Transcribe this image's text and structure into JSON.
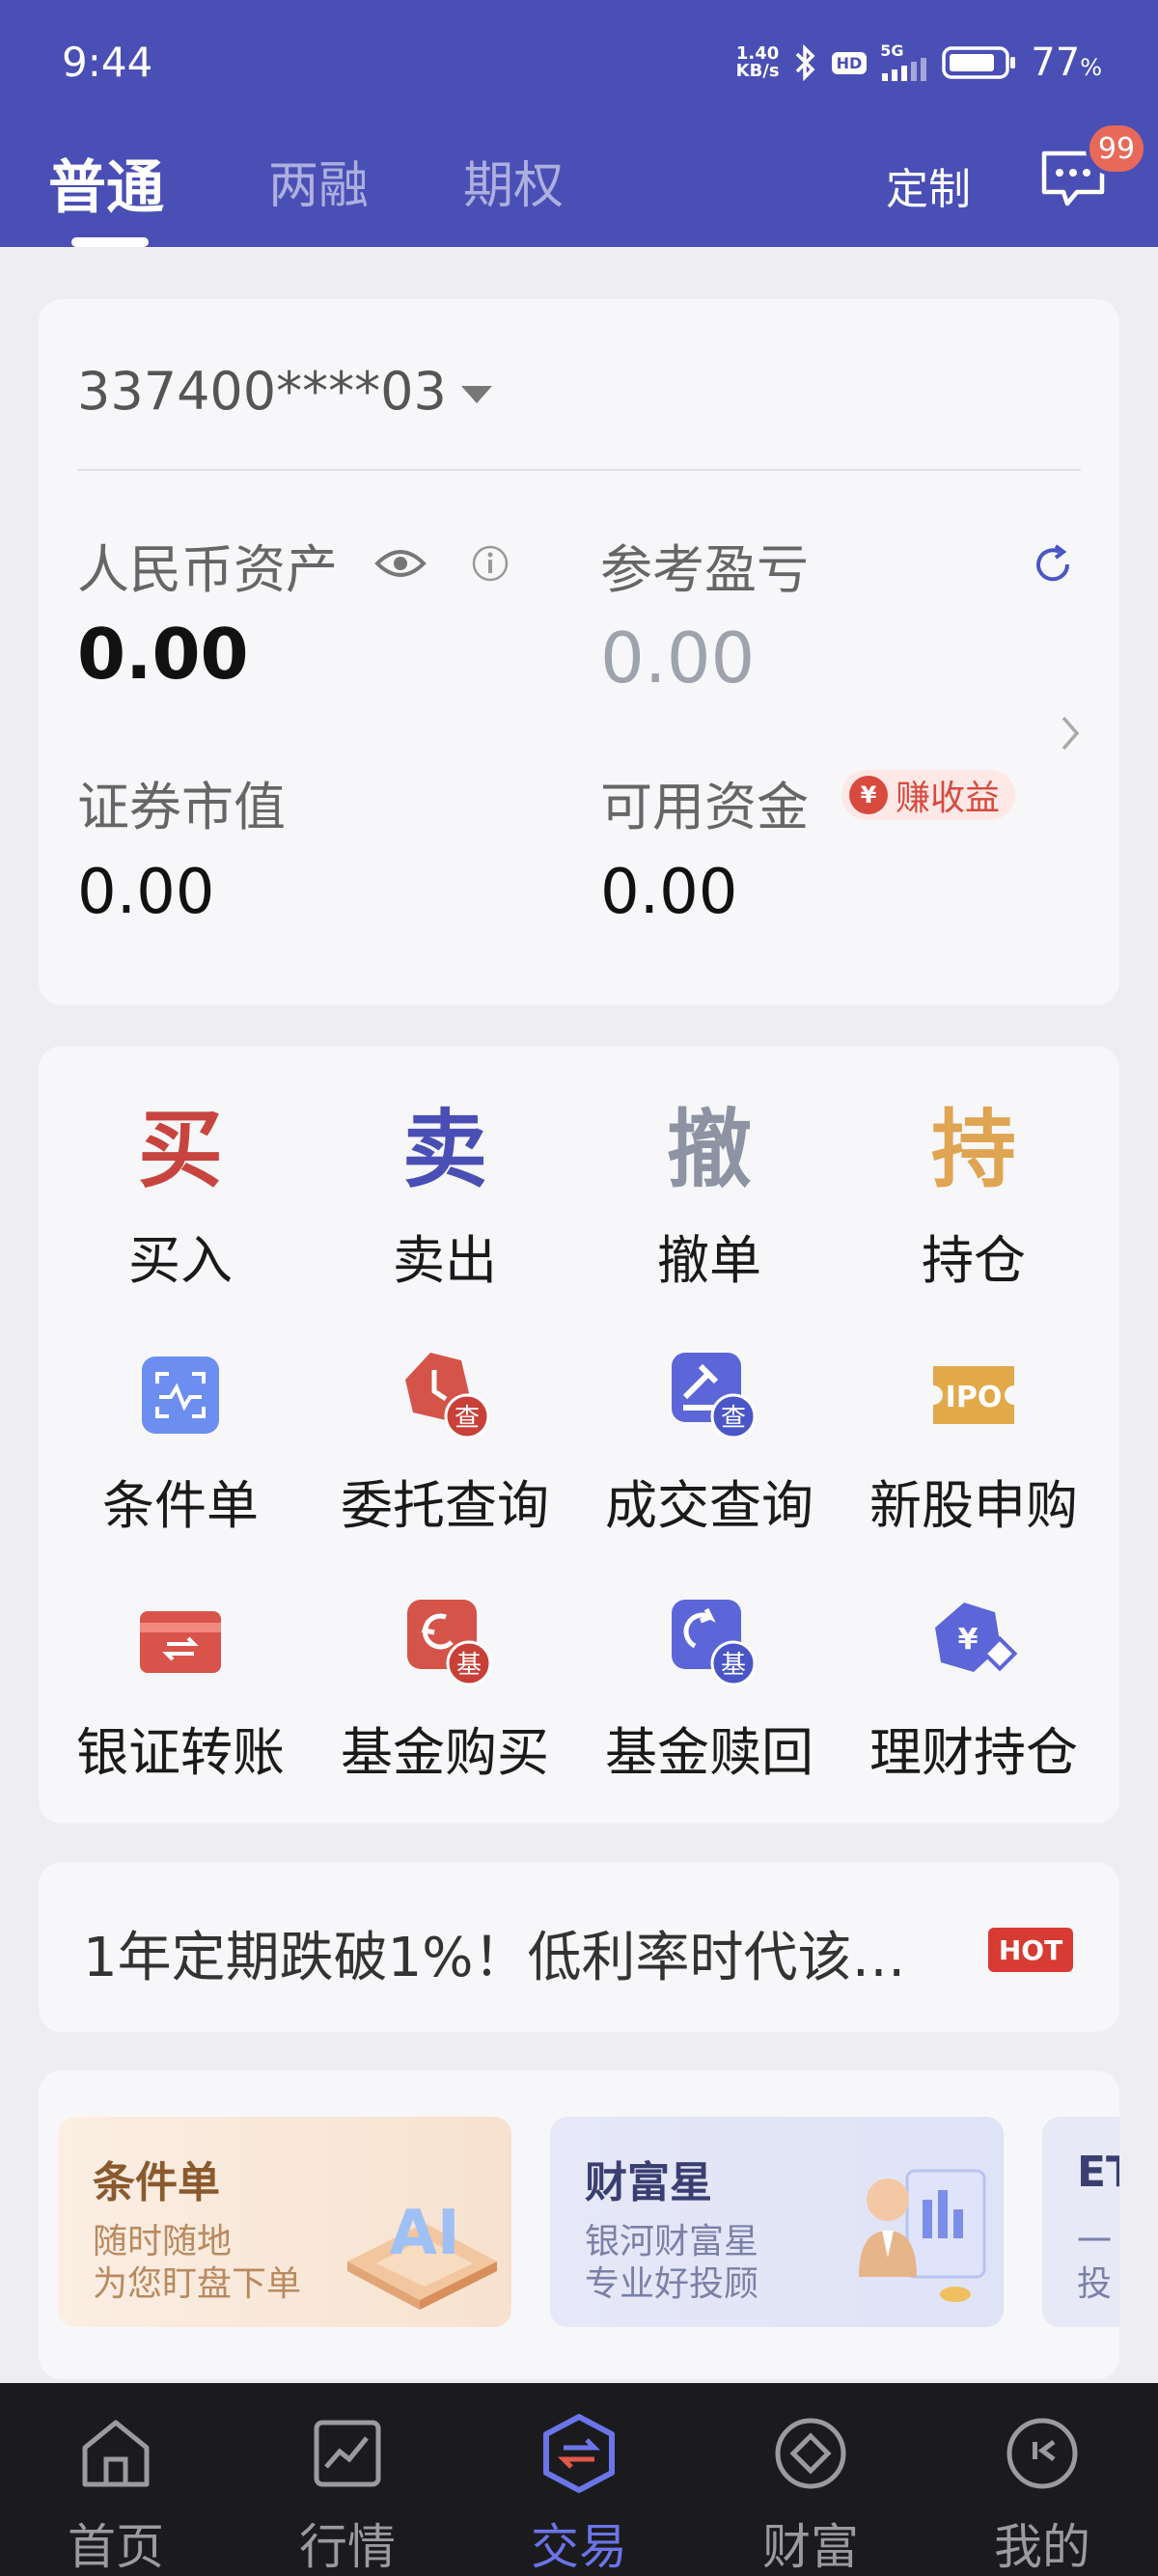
{
  "status_bar": {
    "time": "9:44",
    "net_speed_value": "1.40",
    "net_speed_unit": "KB/s",
    "hd_label": "HD",
    "signal_label": "5G",
    "battery_percent": "77",
    "battery_unit": "%"
  },
  "header": {
    "tabs": [
      {
        "label": "普通",
        "active": true
      },
      {
        "label": "两融",
        "active": false
      },
      {
        "label": "期权",
        "active": false
      }
    ],
    "customize_label": "定制",
    "message_badge": "99",
    "bg_color": "#4a4fb5"
  },
  "account": {
    "number": "337400****03",
    "rmb_assets_label": "人民币资产",
    "rmb_assets_value": "0.00",
    "ref_pnl_label": "参考盈亏",
    "ref_pnl_value": "0.00",
    "market_value_label": "证券市值",
    "market_value_value": "0.00",
    "available_funds_label": "可用资金",
    "available_funds_value": "0.00",
    "earn_badge_icon": "¥",
    "earn_badge_label": "赚收益"
  },
  "trade_actions": [
    {
      "char": "买",
      "label": "买入",
      "color": "#c8453f"
    },
    {
      "char": "卖",
      "label": "卖出",
      "color": "#4a4fb5"
    },
    {
      "char": "撤",
      "label": "撤单",
      "color": "#8d93a3"
    },
    {
      "char": "持",
      "label": "持仓",
      "color": "#e0a552"
    }
  ],
  "quick_tools": [
    {
      "label": "条件单",
      "icon": "condition-order-icon"
    },
    {
      "label": "委托查询",
      "icon": "order-query-icon"
    },
    {
      "label": "成交查询",
      "icon": "deal-query-icon"
    },
    {
      "label": "新股申购",
      "icon": "ipo-icon"
    },
    {
      "label": "银证转账",
      "icon": "bank-transfer-icon"
    },
    {
      "label": "基金购买",
      "icon": "fund-buy-icon"
    },
    {
      "label": "基金赎回",
      "icon": "fund-redeem-icon"
    },
    {
      "label": "理财持仓",
      "icon": "wealth-holdings-icon"
    }
  ],
  "icon_glyphs": {
    "query": "查",
    "fund": "基",
    "ipo": "IPO",
    "yen": "¥"
  },
  "news": {
    "text": "1年定期跌破1%！低利率时代该…",
    "badge": "HOT"
  },
  "promos": [
    {
      "title": "条件单",
      "line1": "随时随地",
      "line2": "为您盯盘下单",
      "art_label": "AI"
    },
    {
      "title": "财富星",
      "line1": "银河财富星",
      "line2": "专业好投顾"
    },
    {
      "title": "ET",
      "line1": "一",
      "line2": "投"
    }
  ],
  "bottom_nav": [
    {
      "label": "首页",
      "icon": "home-icon",
      "active": false
    },
    {
      "label": "行情",
      "icon": "market-chart-icon",
      "active": false
    },
    {
      "label": "交易",
      "icon": "trade-icon",
      "active": true
    },
    {
      "label": "财富",
      "icon": "wealth-icon",
      "active": false
    },
    {
      "label": "我的",
      "icon": "profile-icon",
      "active": false
    }
  ]
}
